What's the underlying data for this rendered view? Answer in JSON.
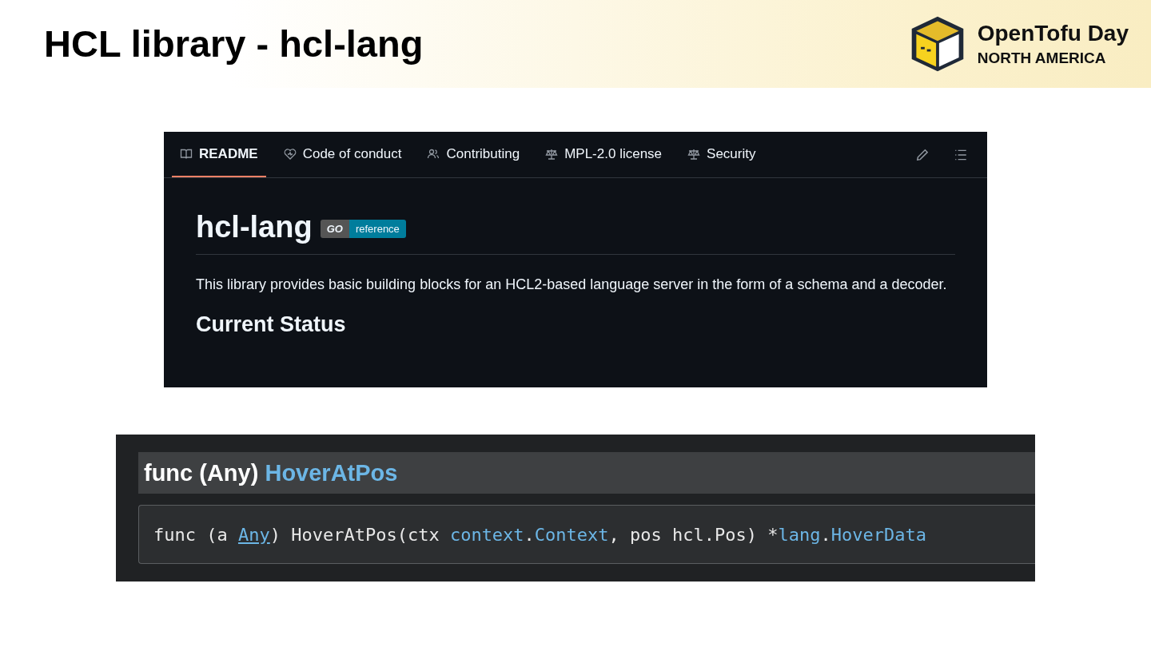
{
  "slide": {
    "title": "HCL library - hcl-lang",
    "logo": {
      "name": "OpenTofu Day",
      "region": "NORTH AMERICA"
    }
  },
  "readme": {
    "tabs": [
      {
        "label": "README",
        "selected": true
      },
      {
        "label": "Code of conduct",
        "selected": false
      },
      {
        "label": "Contributing",
        "selected": false
      },
      {
        "label": "MPL-2.0 license",
        "selected": false
      },
      {
        "label": "Security",
        "selected": false
      }
    ],
    "heading": "hcl-lang",
    "badge": {
      "left": "GO",
      "right": "reference"
    },
    "paragraph": "This library provides basic building blocks for an HCL2-based language server in the form of a schema and a decoder.",
    "subheading": "Current Status"
  },
  "godoc": {
    "heading": {
      "prefix": "func (Any)",
      "name": "HoverAtPos"
    },
    "signature": [
      {
        "text": "func (a ",
        "kind": "plain"
      },
      {
        "text": "Any",
        "kind": "link"
      },
      {
        "text": ") HoverAtPos(ctx ",
        "kind": "plain"
      },
      {
        "text": "context",
        "kind": "type"
      },
      {
        "text": ".",
        "kind": "plain"
      },
      {
        "text": "Context",
        "kind": "type"
      },
      {
        "text": ", pos hcl.Pos) *",
        "kind": "plain"
      },
      {
        "text": "lang",
        "kind": "type"
      },
      {
        "text": ".",
        "kind": "plain"
      },
      {
        "text": "HoverData",
        "kind": "type"
      }
    ]
  }
}
